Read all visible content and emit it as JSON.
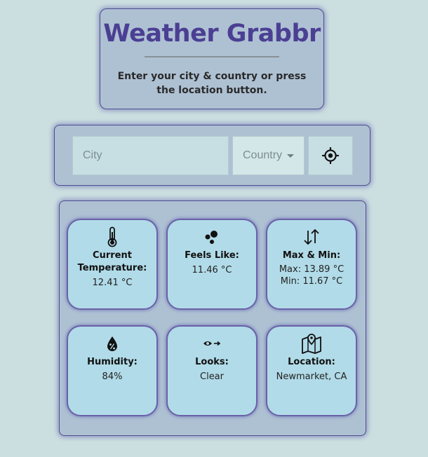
{
  "header": {
    "title": "Weather Grabbr",
    "subtitle": "Enter your city & country or press the location button."
  },
  "search": {
    "city_placeholder": "City",
    "city_value": "",
    "country_placeholder": "Country",
    "locate_icon": "crosshair-icon"
  },
  "weather": {
    "temperature": {
      "label": "Current Temperature:",
      "value": "12.41 °C",
      "icon": "thermometer-icon"
    },
    "feels_like": {
      "label": "Feels Like:",
      "value": "11.46 °C",
      "icon": "bubbles-icon"
    },
    "max_min": {
      "label": "Max & Min:",
      "max": "Max: 13.89 °C",
      "min": "Min: 11.67 °C",
      "icon": "up-down-arrows-icon"
    },
    "humidity": {
      "label": "Humidity:",
      "value": "84%",
      "icon": "humidity-drop-icon"
    },
    "looks": {
      "label": "Looks:",
      "value": "Clear",
      "icon": "eye-arrow-icon"
    },
    "location": {
      "label": "Location:",
      "value": "Newmarket, CA",
      "icon": "map-pin-icon"
    }
  },
  "colors": {
    "background": "#ccdfe0",
    "card": "#aec1d3",
    "tile": "#b1dbe8",
    "title": "#4b3f93",
    "border": "#4e4d8e"
  }
}
